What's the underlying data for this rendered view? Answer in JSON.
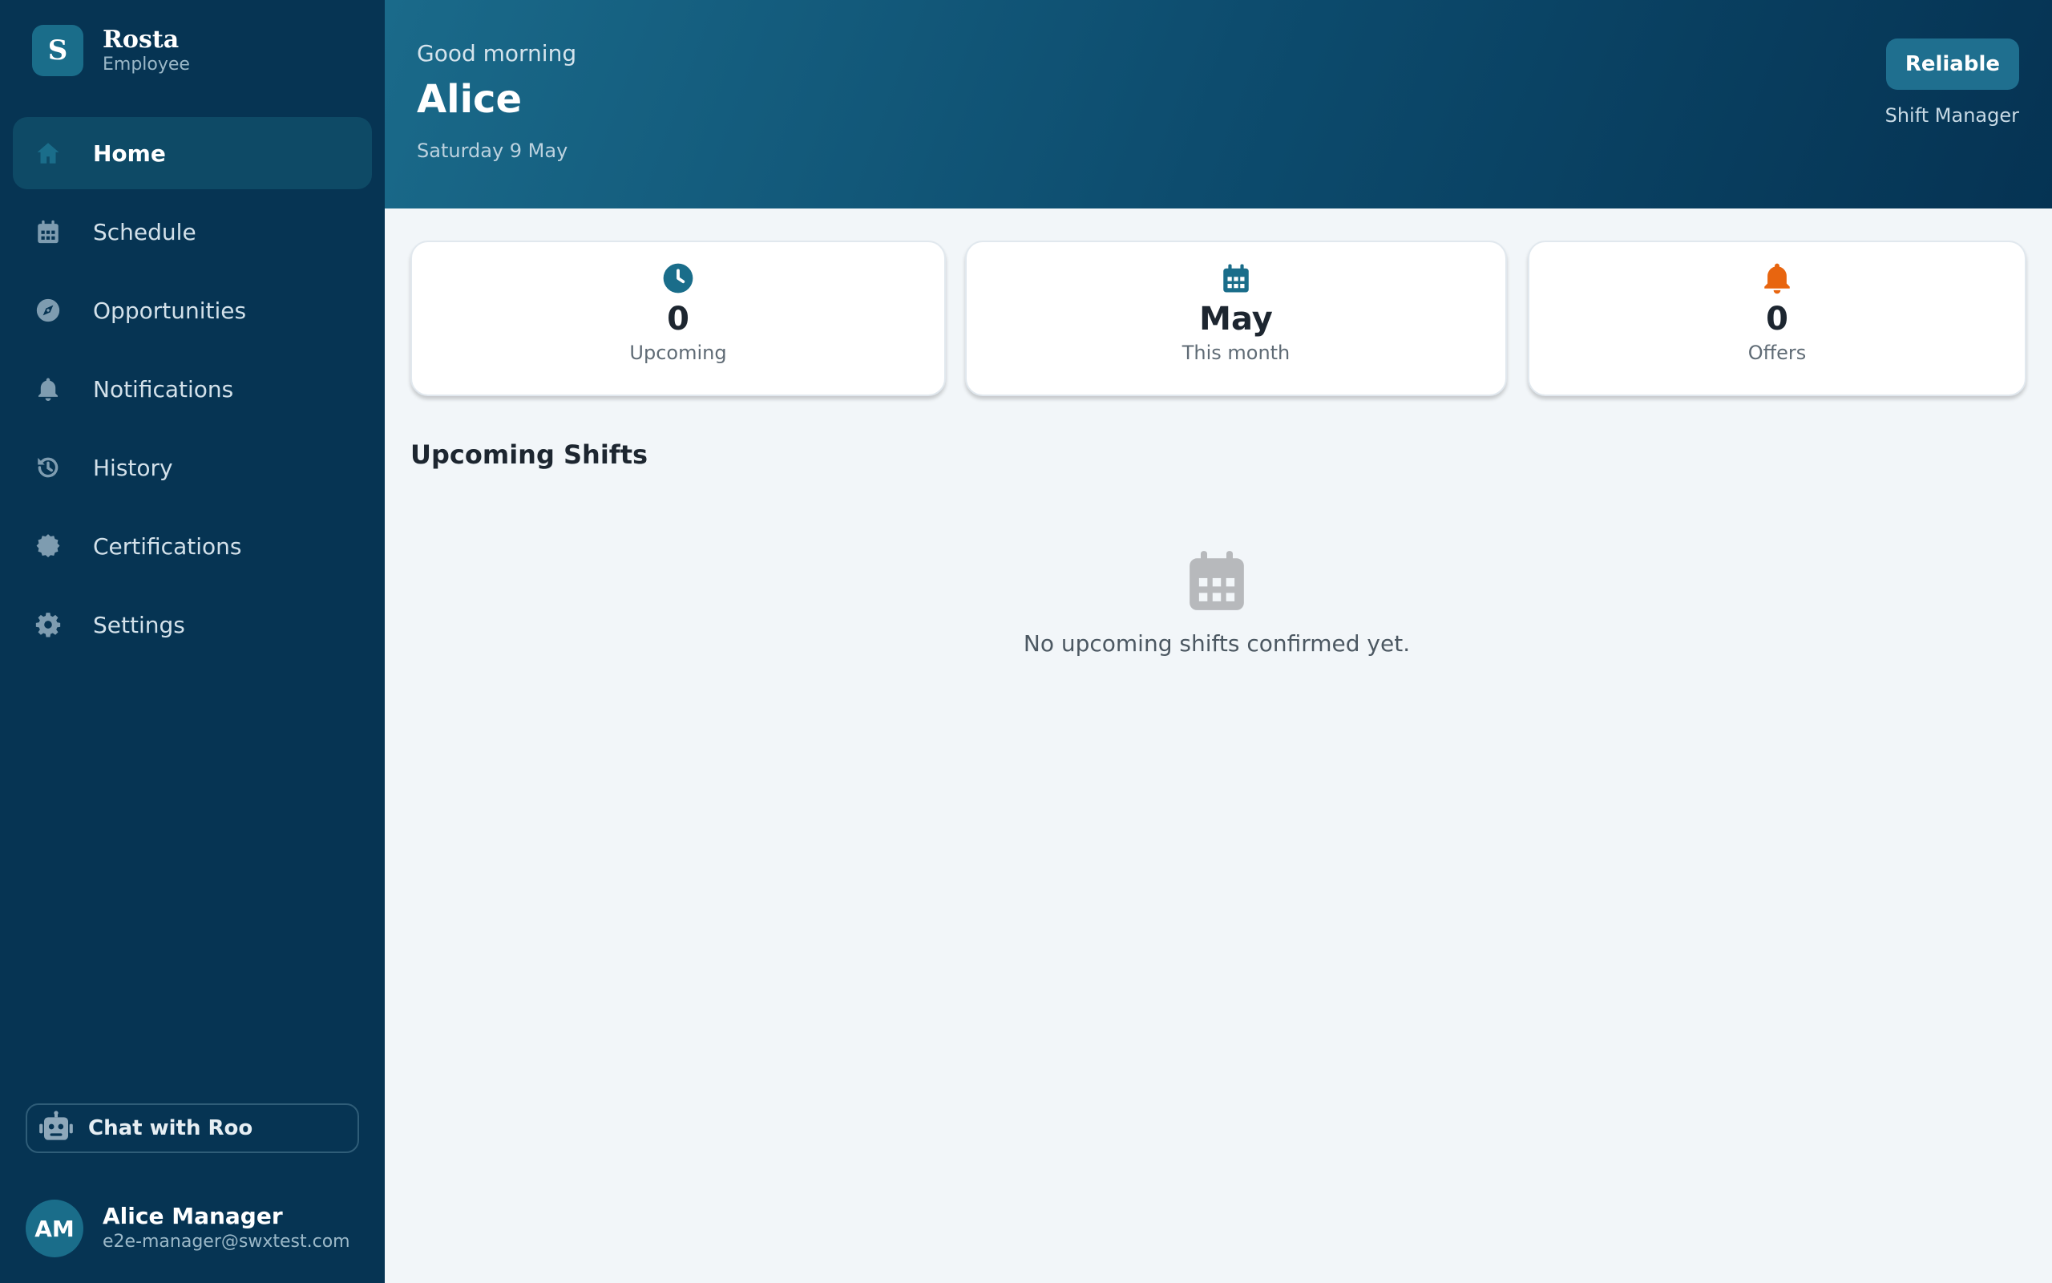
{
  "app": {
    "logo_letter": "S",
    "name": "Rosta",
    "subtitle": "Employee"
  },
  "nav": {
    "items": [
      {
        "label": "Home",
        "icon": "home-icon",
        "active": true
      },
      {
        "label": "Schedule",
        "icon": "calendar-icon"
      },
      {
        "label": "Opportunities",
        "icon": "compass-icon"
      },
      {
        "label": "Notifications",
        "icon": "bell-icon"
      },
      {
        "label": "History",
        "icon": "history-icon"
      },
      {
        "label": "Certifications",
        "icon": "certificate-icon"
      },
      {
        "label": "Settings",
        "icon": "gear-icon"
      }
    ]
  },
  "chat": {
    "label": "Chat with Roo",
    "icon": "robot-icon"
  },
  "user": {
    "initials": "AM",
    "name": "Alice Manager",
    "email": "e2e-manager@swxtest.com"
  },
  "header": {
    "greeting": "Good morning",
    "name": "Alice",
    "date": "Saturday 9 May",
    "badge": "Reliable",
    "role": "Shift Manager"
  },
  "stats": [
    {
      "value": "0",
      "label": "Upcoming",
      "icon": "clock-icon",
      "color": "#1a6d8a"
    },
    {
      "value": "May",
      "label": "This month",
      "icon": "calendar-icon",
      "color": "#1a6d8a"
    },
    {
      "value": "0",
      "label": "Offers",
      "icon": "bell-icon",
      "color": "#e8650f"
    }
  ],
  "upcoming": {
    "title": "Upcoming Shifts",
    "empty_text": "No upcoming shifts confirmed yet.",
    "empty_icon": "calendar-icon"
  },
  "colors": {
    "sidebar": "#063453",
    "accent": "#1a6d8a",
    "offers": "#e8650f",
    "background": "#f2f6f9"
  }
}
